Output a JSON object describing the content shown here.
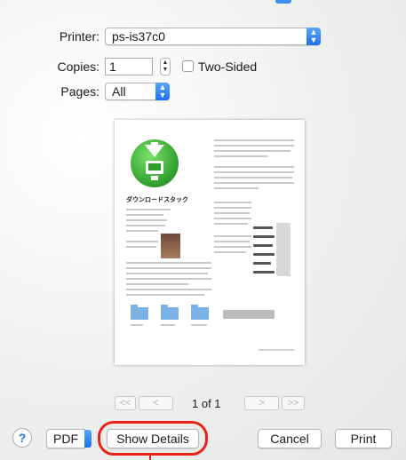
{
  "printer": {
    "label": "Printer:",
    "value": "ps-is37c0"
  },
  "copies": {
    "label": "Copies:",
    "value": "1"
  },
  "two_sided": {
    "label": "Two-Sided",
    "checked": false
  },
  "pages": {
    "label": "Pages:",
    "value": "All"
  },
  "preview": {
    "doc_title": "ダウンロードスタック"
  },
  "navigation": {
    "first": "<<",
    "prev": "<",
    "page_indicator": "1 of 1",
    "next": ">",
    "last": ">>"
  },
  "footer": {
    "help": "?",
    "pdf": "PDF",
    "show_details": "Show Details",
    "cancel": "Cancel",
    "print": "Print"
  },
  "colors": {
    "accent": "#1e6ff0",
    "highlight": "#e8231a"
  }
}
